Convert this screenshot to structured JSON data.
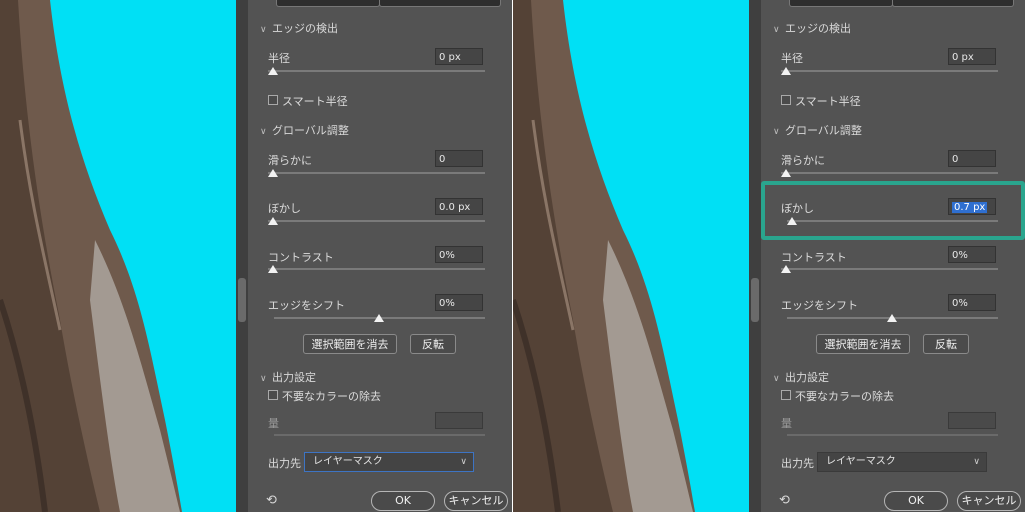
{
  "colors": {
    "canvas_bg": "#00e0f5",
    "panel_bg": "#535353",
    "highlight": "#2aa58e",
    "selection": "#2f6fd0"
  },
  "left": {
    "edge_detection": {
      "section": "エッジの検出",
      "radius_label": "半径",
      "radius_value": "0 px",
      "smart_radius_label": "スマート半径"
    },
    "global": {
      "section": "グローバル調整",
      "smooth_label": "滑らかに",
      "smooth_value": "0",
      "feather_label": "ぼかし",
      "feather_value": "0.0 px",
      "contrast_label": "コントラスト",
      "contrast_value": "0%",
      "shift_label": "エッジをシフト",
      "shift_value": "0%",
      "clear_selection_button": "選択範囲を消去",
      "invert_button": "反転"
    },
    "output": {
      "section": "出力設定",
      "decontaminate_label": "不要なカラーの除去",
      "amount_label": "量",
      "output_to_label": "出力先",
      "output_to_value": "レイヤーマスク"
    },
    "footer": {
      "ok": "OK",
      "cancel": "キャンセル"
    }
  },
  "right": {
    "edge_detection": {
      "section": "エッジの検出",
      "radius_label": "半径",
      "radius_value": "0 px",
      "smart_radius_label": "スマート半径"
    },
    "global": {
      "section": "グローバル調整",
      "smooth_label": "滑らかに",
      "smooth_value": "0",
      "feather_label": "ぼかし",
      "feather_value": "0.7 px",
      "contrast_label": "コントラスト",
      "contrast_value": "0%",
      "shift_label": "エッジをシフト",
      "shift_value": "0%",
      "clear_selection_button": "選択範囲を消去",
      "invert_button": "反転"
    },
    "output": {
      "section": "出力設定",
      "decontaminate_label": "不要なカラーの除去",
      "amount_label": "量",
      "output_to_label": "出力先",
      "output_to_value": "レイヤーマスク"
    },
    "footer": {
      "ok": "OK",
      "cancel": "キャンセル"
    }
  },
  "icons": {
    "section_chevron": "chevron-down-icon",
    "reset": "reset-icon",
    "dropdown": "chevron-down-icon"
  },
  "slider_levels": {
    "edge_shift": 0.5,
    "feather_right": 0.09
  }
}
